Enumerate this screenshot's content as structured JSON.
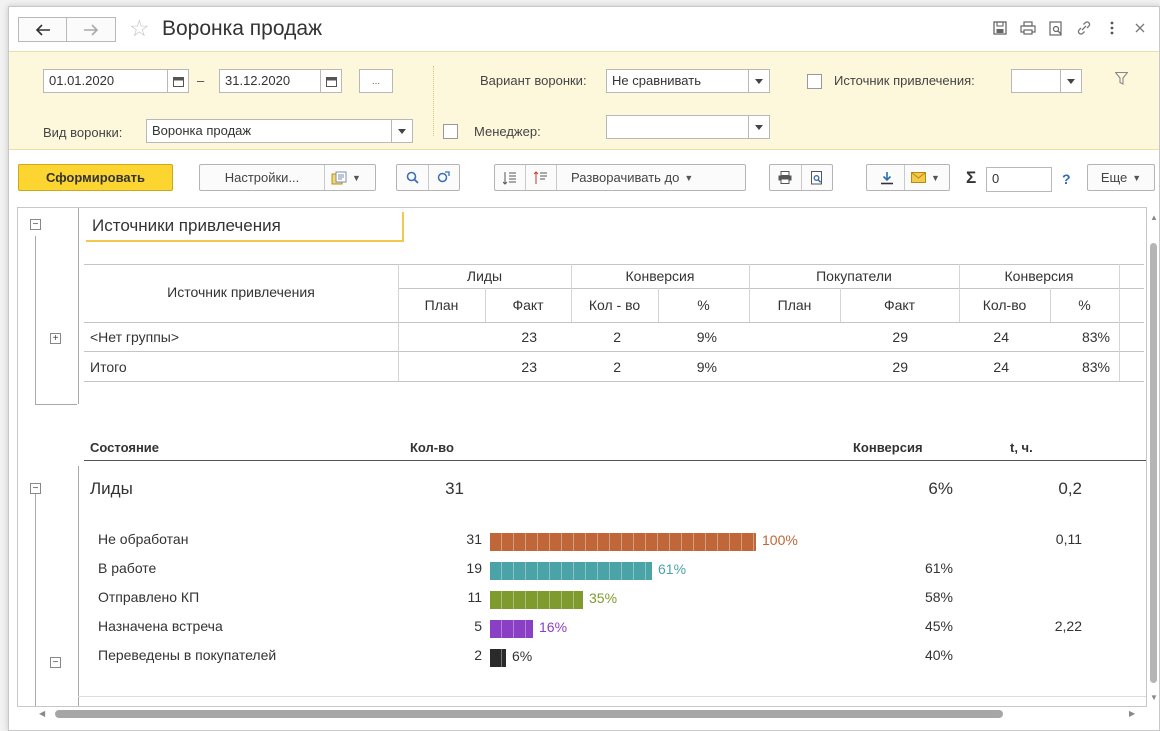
{
  "window": {
    "title": "Воронка продаж"
  },
  "filters": {
    "date_from": "01.01.2020",
    "date_dash": "–",
    "date_to": "31.12.2020",
    "period_btn": "...",
    "funnel_variant_label": "Вариант воронки:",
    "funnel_variant_value": "Не сравнивать",
    "source_label": "Источник привлечения:",
    "source_value": "",
    "funnel_type_label": "Вид воронки:",
    "funnel_type_value": "Воронка продаж",
    "manager_label": "Менеджер:",
    "manager_value": ""
  },
  "toolbar": {
    "generate": "Сформировать",
    "settings": "Настройки...",
    "expand_to": "Разворачивать до",
    "sum_symbol": "Σ",
    "sum_value": "0",
    "help": "?",
    "more": "Еще"
  },
  "report": {
    "sources_title": "Источники привлечения",
    "table": {
      "col_source": "Источник привлечения",
      "group_leads": "Лиды",
      "group_conv1": "Конверсия",
      "group_buyers": "Покупатели",
      "group_conv2": "Конверсия",
      "sub": [
        "План",
        "Факт",
        "Кол - во",
        "%",
        "План",
        "Факт",
        "Кол-во",
        "%"
      ],
      "rows": [
        {
          "name": "<Нет группы>",
          "values": [
            "",
            "23",
            "2",
            "9%",
            "",
            "29",
            "24",
            "83%"
          ]
        },
        {
          "name": "Итого",
          "values": [
            "",
            "23",
            "2",
            "9%",
            "",
            "29",
            "24",
            "83%"
          ]
        }
      ]
    },
    "funnel": {
      "hdr_state": "Состояние",
      "hdr_count": "Кол-во",
      "hdr_conv": "Конверсия",
      "hdr_time": "t, ч.",
      "group_name": "Лиды",
      "group_count": "31",
      "group_conv": "6%",
      "group_time": "0,2",
      "stages": [
        {
          "name": "Не обработан",
          "count": "31",
          "share": 100,
          "share_label": "100%",
          "conv": "",
          "time": "0,11",
          "color": "#c0673a"
        },
        {
          "name": "В работе",
          "count": "19",
          "share": 61,
          "share_label": "61%",
          "conv": "61%",
          "time": "",
          "color": "#4aa3a6"
        },
        {
          "name": "Отправлено КП",
          "count": "11",
          "share": 35,
          "share_label": "35%",
          "conv": "58%",
          "time": "",
          "color": "#7f9b2e"
        },
        {
          "name": "Назначена встреча",
          "count": "5",
          "share": 16,
          "share_label": "16%",
          "conv": "45%",
          "time": "2,22",
          "color": "#8a3fc4"
        },
        {
          "name": "Переведены в покупателей",
          "count": "2",
          "share": 6,
          "share_label": "6%",
          "conv": "40%",
          "time": "",
          "color": "#2a2a2a"
        }
      ]
    }
  }
}
